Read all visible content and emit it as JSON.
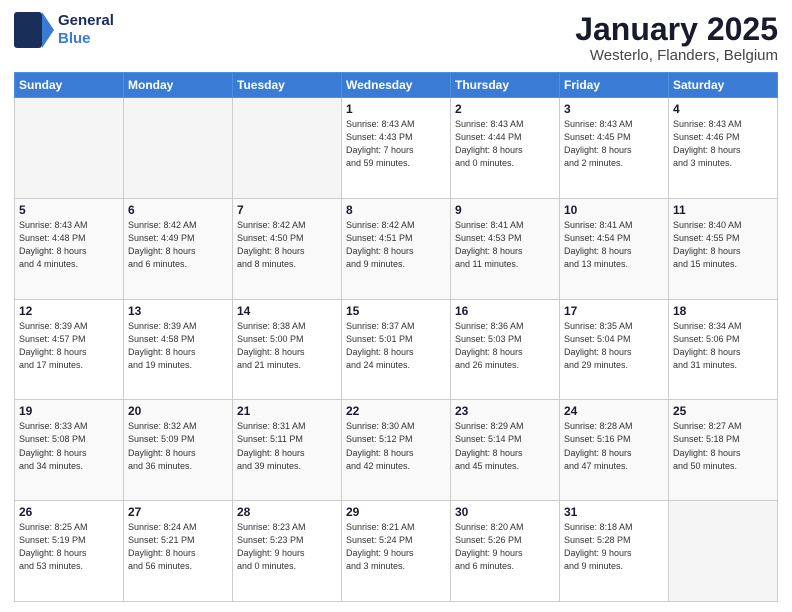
{
  "logo": {
    "line1": "General",
    "line2": "Blue"
  },
  "title": "January 2025",
  "subtitle": "Westerlo, Flanders, Belgium",
  "weekdays": [
    "Sunday",
    "Monday",
    "Tuesday",
    "Wednesday",
    "Thursday",
    "Friday",
    "Saturday"
  ],
  "weeks": [
    [
      {
        "day": "",
        "info": ""
      },
      {
        "day": "",
        "info": ""
      },
      {
        "day": "",
        "info": ""
      },
      {
        "day": "1",
        "info": "Sunrise: 8:43 AM\nSunset: 4:43 PM\nDaylight: 7 hours\nand 59 minutes."
      },
      {
        "day": "2",
        "info": "Sunrise: 8:43 AM\nSunset: 4:44 PM\nDaylight: 8 hours\nand 0 minutes."
      },
      {
        "day": "3",
        "info": "Sunrise: 8:43 AM\nSunset: 4:45 PM\nDaylight: 8 hours\nand 2 minutes."
      },
      {
        "day": "4",
        "info": "Sunrise: 8:43 AM\nSunset: 4:46 PM\nDaylight: 8 hours\nand 3 minutes."
      }
    ],
    [
      {
        "day": "5",
        "info": "Sunrise: 8:43 AM\nSunset: 4:48 PM\nDaylight: 8 hours\nand 4 minutes."
      },
      {
        "day": "6",
        "info": "Sunrise: 8:42 AM\nSunset: 4:49 PM\nDaylight: 8 hours\nand 6 minutes."
      },
      {
        "day": "7",
        "info": "Sunrise: 8:42 AM\nSunset: 4:50 PM\nDaylight: 8 hours\nand 8 minutes."
      },
      {
        "day": "8",
        "info": "Sunrise: 8:42 AM\nSunset: 4:51 PM\nDaylight: 8 hours\nand 9 minutes."
      },
      {
        "day": "9",
        "info": "Sunrise: 8:41 AM\nSunset: 4:53 PM\nDaylight: 8 hours\nand 11 minutes."
      },
      {
        "day": "10",
        "info": "Sunrise: 8:41 AM\nSunset: 4:54 PM\nDaylight: 8 hours\nand 13 minutes."
      },
      {
        "day": "11",
        "info": "Sunrise: 8:40 AM\nSunset: 4:55 PM\nDaylight: 8 hours\nand 15 minutes."
      }
    ],
    [
      {
        "day": "12",
        "info": "Sunrise: 8:39 AM\nSunset: 4:57 PM\nDaylight: 8 hours\nand 17 minutes."
      },
      {
        "day": "13",
        "info": "Sunrise: 8:39 AM\nSunset: 4:58 PM\nDaylight: 8 hours\nand 19 minutes."
      },
      {
        "day": "14",
        "info": "Sunrise: 8:38 AM\nSunset: 5:00 PM\nDaylight: 8 hours\nand 21 minutes."
      },
      {
        "day": "15",
        "info": "Sunrise: 8:37 AM\nSunset: 5:01 PM\nDaylight: 8 hours\nand 24 minutes."
      },
      {
        "day": "16",
        "info": "Sunrise: 8:36 AM\nSunset: 5:03 PM\nDaylight: 8 hours\nand 26 minutes."
      },
      {
        "day": "17",
        "info": "Sunrise: 8:35 AM\nSunset: 5:04 PM\nDaylight: 8 hours\nand 29 minutes."
      },
      {
        "day": "18",
        "info": "Sunrise: 8:34 AM\nSunset: 5:06 PM\nDaylight: 8 hours\nand 31 minutes."
      }
    ],
    [
      {
        "day": "19",
        "info": "Sunrise: 8:33 AM\nSunset: 5:08 PM\nDaylight: 8 hours\nand 34 minutes."
      },
      {
        "day": "20",
        "info": "Sunrise: 8:32 AM\nSunset: 5:09 PM\nDaylight: 8 hours\nand 36 minutes."
      },
      {
        "day": "21",
        "info": "Sunrise: 8:31 AM\nSunset: 5:11 PM\nDaylight: 8 hours\nand 39 minutes."
      },
      {
        "day": "22",
        "info": "Sunrise: 8:30 AM\nSunset: 5:12 PM\nDaylight: 8 hours\nand 42 minutes."
      },
      {
        "day": "23",
        "info": "Sunrise: 8:29 AM\nSunset: 5:14 PM\nDaylight: 8 hours\nand 45 minutes."
      },
      {
        "day": "24",
        "info": "Sunrise: 8:28 AM\nSunset: 5:16 PM\nDaylight: 8 hours\nand 47 minutes."
      },
      {
        "day": "25",
        "info": "Sunrise: 8:27 AM\nSunset: 5:18 PM\nDaylight: 8 hours\nand 50 minutes."
      }
    ],
    [
      {
        "day": "26",
        "info": "Sunrise: 8:25 AM\nSunset: 5:19 PM\nDaylight: 8 hours\nand 53 minutes."
      },
      {
        "day": "27",
        "info": "Sunrise: 8:24 AM\nSunset: 5:21 PM\nDaylight: 8 hours\nand 56 minutes."
      },
      {
        "day": "28",
        "info": "Sunrise: 8:23 AM\nSunset: 5:23 PM\nDaylight: 9 hours\nand 0 minutes."
      },
      {
        "day": "29",
        "info": "Sunrise: 8:21 AM\nSunset: 5:24 PM\nDaylight: 9 hours\nand 3 minutes."
      },
      {
        "day": "30",
        "info": "Sunrise: 8:20 AM\nSunset: 5:26 PM\nDaylight: 9 hours\nand 6 minutes."
      },
      {
        "day": "31",
        "info": "Sunrise: 8:18 AM\nSunset: 5:28 PM\nDaylight: 9 hours\nand 9 minutes."
      },
      {
        "day": "",
        "info": ""
      }
    ]
  ]
}
